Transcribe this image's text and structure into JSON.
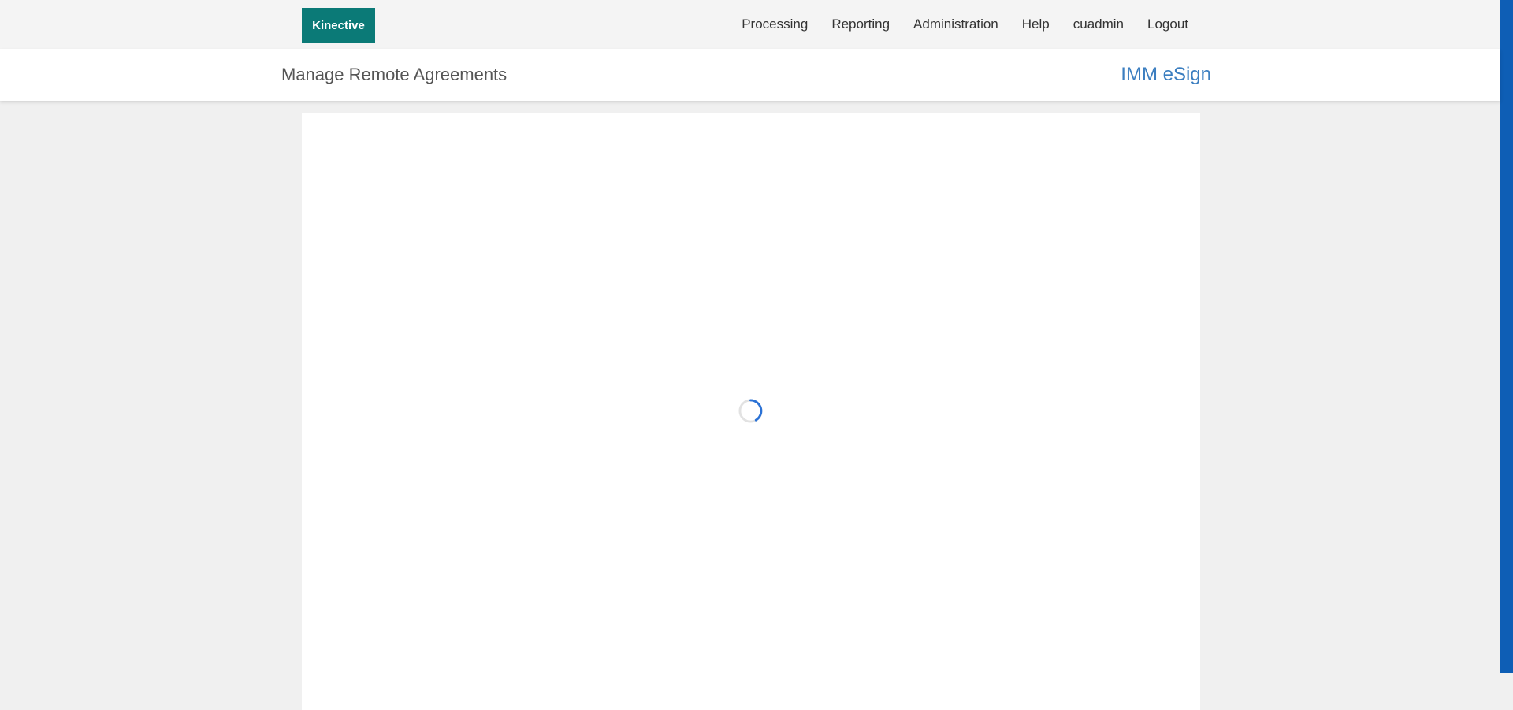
{
  "header": {
    "logo_text": "Kinective",
    "nav_items": [
      {
        "label": "Processing"
      },
      {
        "label": "Reporting"
      },
      {
        "label": "Administration"
      },
      {
        "label": "Help"
      },
      {
        "label": "cuadmin"
      },
      {
        "label": "Logout"
      }
    ]
  },
  "subheader": {
    "title": "Manage Remote Agreements",
    "brand": "IMM eSign"
  },
  "content": {
    "loading": true
  },
  "colors": {
    "logo_bg": "#0b7a77",
    "brand_link": "#3b7ec0",
    "spinner": "#2b72d6",
    "scrollbar": "#0e5eb5"
  },
  "icons": {
    "spinner": "loading-spinner-icon"
  }
}
